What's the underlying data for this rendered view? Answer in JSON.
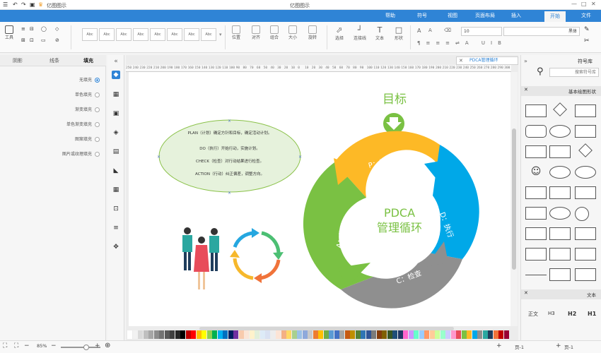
{
  "app": {
    "title": "亿图图示"
  },
  "titlebar_icons": [
    "menu-icon",
    "undo-icon",
    "redo-icon",
    "save-icon",
    "open-icon",
    "print-icon",
    "export-icon",
    "more-icon"
  ],
  "tabs": [
    {
      "label": "文件"
    },
    {
      "label": "开始"
    },
    {
      "label": "插入"
    },
    {
      "label": "页面布局"
    },
    {
      "label": "视图"
    },
    {
      "label": "符号"
    },
    {
      "label": "帮助"
    }
  ],
  "ribbon": {
    "tool_labels": [
      "工具",
      "选择",
      "连接线",
      "文本",
      "形状",
      "填充",
      "线条",
      "阴影"
    ],
    "style_sample": "Abc",
    "font_name": "黑体",
    "font_size": "10",
    "arrange_labels": [
      "位置",
      "对齐",
      "组合",
      "大小",
      "旋转"
    ]
  },
  "left_panel": {
    "tabs": [
      "填充",
      "线条",
      "阴影"
    ],
    "fill_options": [
      "无填充",
      "单色填充",
      "渐变填充",
      "单色渐变填充",
      "图案填充",
      "图片或纹理填充"
    ]
  },
  "document": {
    "tab_label": "PDCA管理循环"
  },
  "ruler": {
    "ticks": [
      "250",
      "240",
      "230",
      "220",
      "210",
      "200",
      "190",
      "180",
      "170",
      "160",
      "150",
      "140",
      "130",
      "120",
      "110",
      "100",
      "90",
      "80",
      "70",
      "60",
      "50",
      "40",
      "30",
      "20",
      "10",
      "0",
      "10",
      "20",
      "30",
      "40",
      "50",
      "60",
      "70",
      "80",
      "90",
      "100",
      "110",
      "120",
      "130",
      "140",
      "150",
      "160",
      "170",
      "180",
      "190",
      "200",
      "210",
      "220",
      "230",
      "240",
      "250",
      "260",
      "270",
      "280",
      "290",
      "300"
    ]
  },
  "diagram": {
    "goal_label": "目标",
    "center_title_1": "PDCA",
    "center_title_2": "管理循环",
    "segments": [
      {
        "label": "P：计划",
        "color": "#fdb926"
      },
      {
        "label": "D：执行",
        "color": "#00a8e8"
      },
      {
        "label": "C：检查",
        "color": "#8f8f8f"
      },
      {
        "label": "A：行动",
        "color": "#7ac143"
      }
    ],
    "ellipse_lines": [
      "PLAN（计划）确定方针和目标，确定活动计划。",
      "DO（执行）开始行动，实施计划。",
      "CHECK（检查）对行动结果进行检查。",
      "ACTION（行动）纠正偏差，调整方向。"
    ]
  },
  "right_panel": {
    "title": "符号库",
    "search_placeholder": "搜索符号库",
    "section_basic": "基本绘图形状",
    "section_text": "文本",
    "text_samples": [
      "H1",
      "H2",
      "H3",
      "正文"
    ]
  },
  "status": {
    "zoom": "85%",
    "page_left": "页-1",
    "page_right": "页-1",
    "add_page": "+"
  },
  "colors": {
    "accent": "#2f84d6",
    "green": "#7ac143",
    "yellow": "#fdb926",
    "blue": "#00a8e8",
    "gray": "#8f8f8f",
    "ellipse_fill": "#e6f2dc",
    "ellipse_stroke": "#8bc24a"
  }
}
